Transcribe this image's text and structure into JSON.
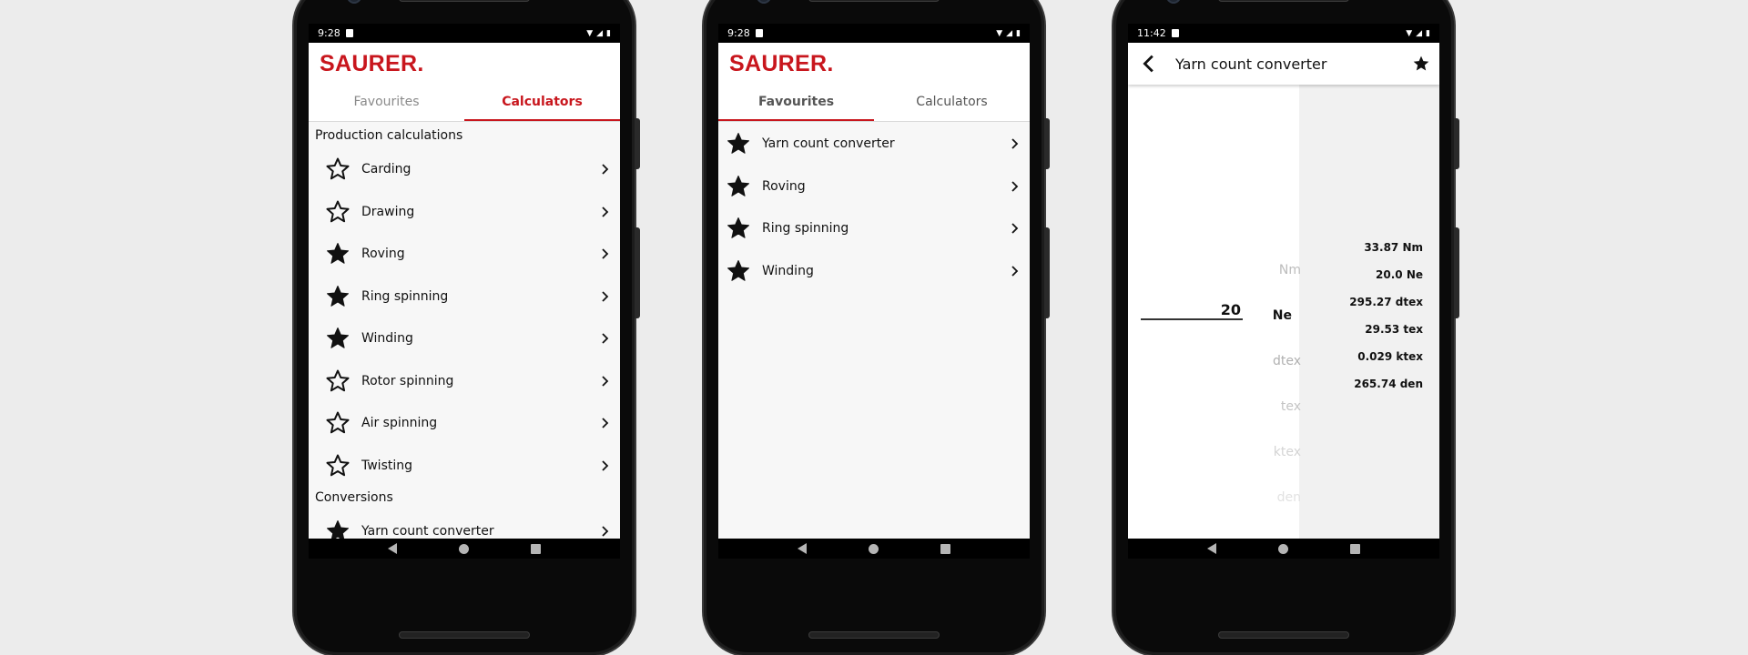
{
  "phones": [
    {
      "status_time": "9:28",
      "logo": "SAURER.",
      "tabs": [
        "Favourites",
        "Calculators"
      ],
      "sections": [
        {
          "title": "Production calculations",
          "items": [
            {
              "label": "Carding",
              "favourite": false
            },
            {
              "label": "Drawing",
              "favourite": false
            },
            {
              "label": "Roving",
              "favourite": true
            },
            {
              "label": "Ring spinning",
              "favourite": true
            },
            {
              "label": "Winding",
              "favourite": true
            },
            {
              "label": "Rotor spinning",
              "favourite": false
            },
            {
              "label": "Air spinning",
              "favourite": false
            },
            {
              "label": "Twisting",
              "favourite": false
            }
          ]
        },
        {
          "title": "Conversions",
          "items": [
            {
              "label": "Yarn count converter",
              "favourite": true
            }
          ]
        }
      ]
    },
    {
      "status_time": "9:28",
      "logo": "SAURER.",
      "tabs": [
        "Favourites",
        "Calculators"
      ],
      "items": [
        {
          "label": "Yarn count converter",
          "favourite": true
        },
        {
          "label": "Roving",
          "favourite": true
        },
        {
          "label": "Ring spinning",
          "favourite": true
        },
        {
          "label": "Winding",
          "favourite": true
        }
      ]
    },
    {
      "status_time": "11:42",
      "title": "Yarn count converter",
      "input_value": "20",
      "units": [
        {
          "label": "Nm",
          "selected": false
        },
        {
          "label": "Ne",
          "selected": true
        },
        {
          "label": "dtex",
          "selected": false
        },
        {
          "label": "tex",
          "selected": false
        },
        {
          "label": "ktex",
          "selected": false
        },
        {
          "label": "den",
          "selected": false
        }
      ],
      "results": [
        "33.87 Nm",
        "20.0 Ne",
        "295.27 dtex",
        "29.53 tex",
        "0.029 ktex",
        "265.74 den"
      ]
    }
  ],
  "colors": {
    "brand_red": "#c8161d",
    "background": "#ececec"
  },
  "icons": [
    "star-outline-icon",
    "star-filled-icon",
    "chevron-right-icon",
    "back-arrow-icon",
    "nav-back-icon",
    "nav-home-icon",
    "nav-recent-icon"
  ]
}
